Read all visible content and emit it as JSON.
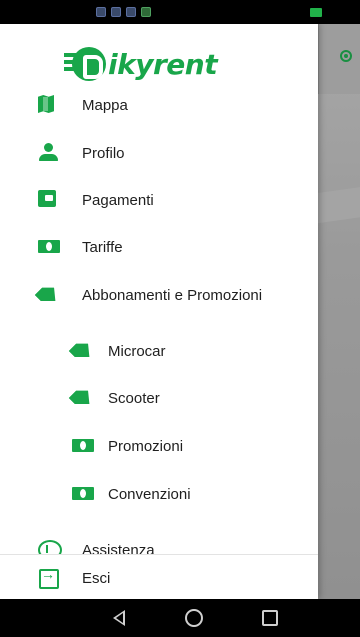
{
  "app": {
    "logo_text": "ikyrent",
    "brand_color": "#19a64a"
  },
  "menu": {
    "items": [
      {
        "label": "Mappa",
        "icon": "map-icon"
      },
      {
        "label": "Profilo",
        "icon": "person-icon"
      },
      {
        "label": "Pagamenti",
        "icon": "wallet-icon"
      },
      {
        "label": "Tariffe",
        "icon": "cash-icon"
      },
      {
        "label": "Abbonamenti e Promozioni",
        "icon": "tag-icon"
      }
    ],
    "subitems": [
      {
        "label": "Microcar",
        "icon": "tag-icon"
      },
      {
        "label": "Scooter",
        "icon": "tag-icon"
      },
      {
        "label": "Promozioni",
        "icon": "cash-icon"
      },
      {
        "label": "Convenzioni",
        "icon": "cash-icon"
      }
    ],
    "assistenza_label": "Assistenza",
    "exit_label": "Esci"
  }
}
